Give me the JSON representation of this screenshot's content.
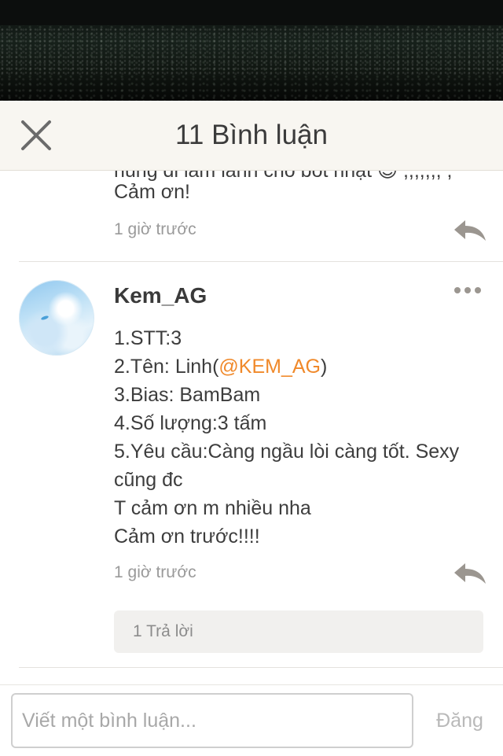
{
  "header": {
    "title": "11 Bình luận",
    "close_icon": "close-icon"
  },
  "previous_comment": {
    "partial_line": "nùng di làm lanh cho bót nhạt 😊 ,,,,,,, ,",
    "text": "Cảm ơn!",
    "time": "1 giờ trước",
    "reply_icon": "reply-arrow-icon"
  },
  "comment": {
    "username": "Kem_AG",
    "more_icon": "more-dots-icon",
    "lines": {
      "l1": "1.STT:3",
      "l2_prefix": "2.Tên: Linh(",
      "l2_mention": "@KEM_AG",
      "l2_suffix": ")",
      "l3": "3.Bias: BamBam",
      "l4": "4.Số lượng:3 tấm",
      "l5": "5.Yêu cầu:Càng ngầu lòi càng tốt. Sexy",
      "l6": "cũng đc",
      "l7": "T cảm ơn m nhiều nha",
      "l8": "Cảm ơn trước!!!!"
    },
    "time": "1 giờ trước",
    "reply_icon": "reply-arrow-icon",
    "replies_label": "1 Trả lời"
  },
  "composer": {
    "placeholder": "Viết một bình luận...",
    "value": "",
    "post_label": "Đăng"
  },
  "colors": {
    "mention": "#f0892a",
    "header_bg": "#f8f6f1",
    "icon_gray": "#9b9690",
    "muted_text": "#9a9a9a"
  }
}
